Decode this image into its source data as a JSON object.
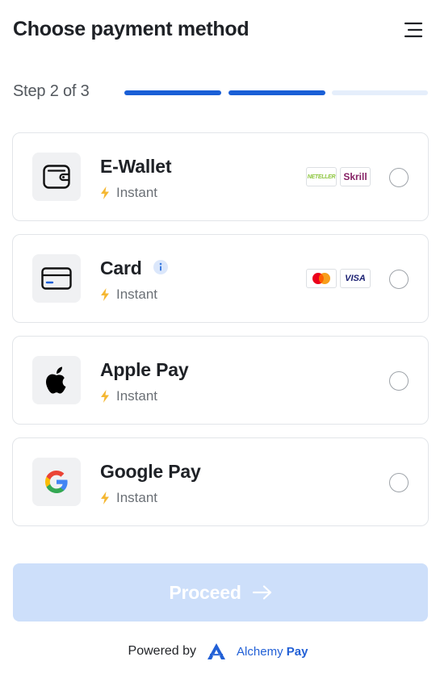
{
  "header": {
    "title": "Choose payment method",
    "menu_icon": "menu-icon"
  },
  "progress": {
    "label": "Step 2 of 3",
    "current_step": 2,
    "total_steps": 3
  },
  "methods": [
    {
      "name": "E-Wallet",
      "icon": "wallet-icon",
      "speed": "Instant",
      "has_info": false,
      "logos": [
        {
          "label": "NETELLER",
          "icon": "neteller-logo",
          "color": "#8dc63f"
        },
        {
          "label": "Skrill",
          "icon": "skrill-logo",
          "color": "#862165"
        }
      ],
      "selected": false
    },
    {
      "name": "Card",
      "icon": "credit-card-icon",
      "speed": "Instant",
      "has_info": true,
      "logos": [
        {
          "label": "",
          "icon": "mastercard-logo",
          "color": "#eb001b"
        },
        {
          "label": "VISA",
          "icon": "visa-logo",
          "color": "#1a1f71"
        }
      ],
      "selected": false
    },
    {
      "name": "Apple Pay",
      "icon": "apple-logo-icon",
      "speed": "Instant",
      "has_info": false,
      "logos": [],
      "selected": false
    },
    {
      "name": "Google Pay",
      "icon": "google-logo-icon",
      "speed": "Instant",
      "has_info": false,
      "logos": [],
      "selected": false
    }
  ],
  "proceed": {
    "label": "Proceed",
    "icon": "arrow-right-icon",
    "enabled": false
  },
  "footer": {
    "powered_by": "Powered by",
    "brand_prefix": "Alchemy",
    "brand_suffix": "Pay",
    "brand_icon": "alchemy-pay-logo"
  },
  "colors": {
    "accent": "#1a5fd6",
    "progress_inactive": "#e5eefb",
    "proceed_disabled": "#cddffa",
    "instant_bolt": "#f5b731",
    "info_badge_bg": "#dbe7fb",
    "info_badge_fg": "#3b7be0"
  }
}
